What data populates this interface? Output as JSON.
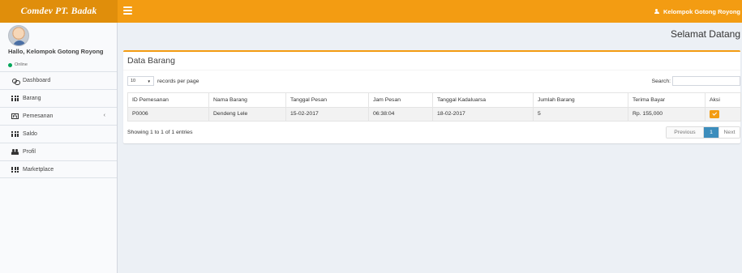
{
  "brand": {
    "logo": "Comdev PT. Badak"
  },
  "header": {
    "user_label": "Kelompok Gotong Royong"
  },
  "sidebar": {
    "user_name": "Hallo, Kelompok Gotong Royong",
    "status": "Online",
    "items": [
      {
        "label": "Dashboard",
        "icon": "dashboard-icon"
      },
      {
        "label": "Barang",
        "icon": "grid-icon"
      },
      {
        "label": "Pemesanan",
        "icon": "chart-icon",
        "caret": "‹"
      },
      {
        "label": "Saldo",
        "icon": "grid-icon"
      },
      {
        "label": "Profil",
        "icon": "users-icon"
      },
      {
        "label": "Marketplace",
        "icon": "grid-icon"
      }
    ]
  },
  "page": {
    "title": "Selamat Datang"
  },
  "box": {
    "title": "Data Barang",
    "length_value": "10",
    "length_suffix": "records per page",
    "search_label": "Search:",
    "search_value": "",
    "columns": [
      "ID Pemesanan",
      "Nama Barang",
      "Tanggal Pesan",
      "Jam Pesan",
      "Tanggal Kadaluarsa",
      "Jumlah Barang",
      "Terima Bayar",
      "Aksi"
    ],
    "rows": [
      [
        "P0006",
        "Dendeng Lele",
        "15-02-2017",
        "06:38:04",
        "18-02-2017",
        "5",
        "Rp. 155,000"
      ]
    ],
    "info": "Showing 1 to 1 of 1 entries",
    "pagination": {
      "previous": "Previous",
      "current": "1",
      "next": "Next"
    }
  },
  "colors": {
    "accent": "#f39c12",
    "accent_dark": "#e08e0b",
    "status_online": "#00a65a",
    "page_active": "#3c8dbc"
  }
}
